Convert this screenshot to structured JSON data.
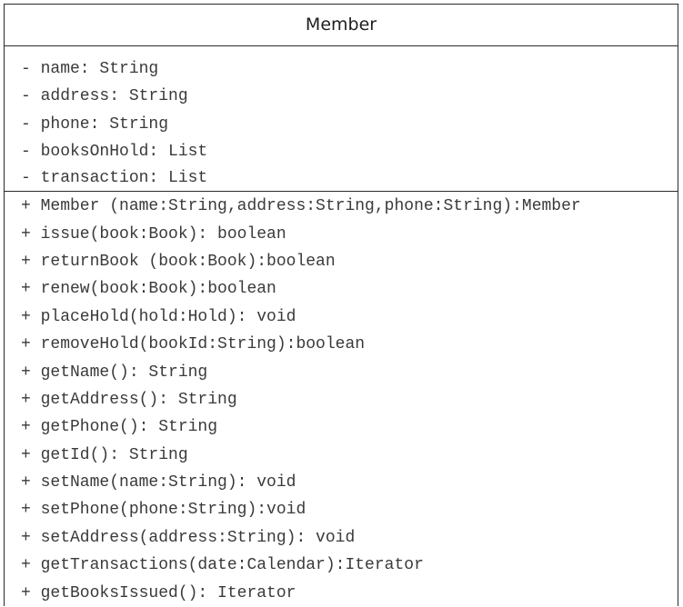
{
  "class_name": "Member",
  "attributes": [
    "- name: String",
    "- address: String",
    "- phone: String",
    "- booksOnHold: List",
    "- transaction: List"
  ],
  "operations": [
    "+ Member (name:String,address:String,phone:String):Member",
    "+ issue(book:Book): boolean",
    "+ returnBook (book:Book):boolean",
    "+ renew(book:Book):boolean",
    "+ placeHold(hold:Hold): void",
    "+ removeHold(bookId:String):boolean",
    "+ getName(): String",
    "+ getAddress(): String",
    "+ getPhone(): String",
    "+ getId(): String",
    "+ setName(name:String): void",
    "+ setPhone(phone:String):void",
    "+ setAddress(address:String): void",
    "+ getTransactions(date:Calendar):Iterator",
    "+ getBooksIssued(): Iterator"
  ]
}
